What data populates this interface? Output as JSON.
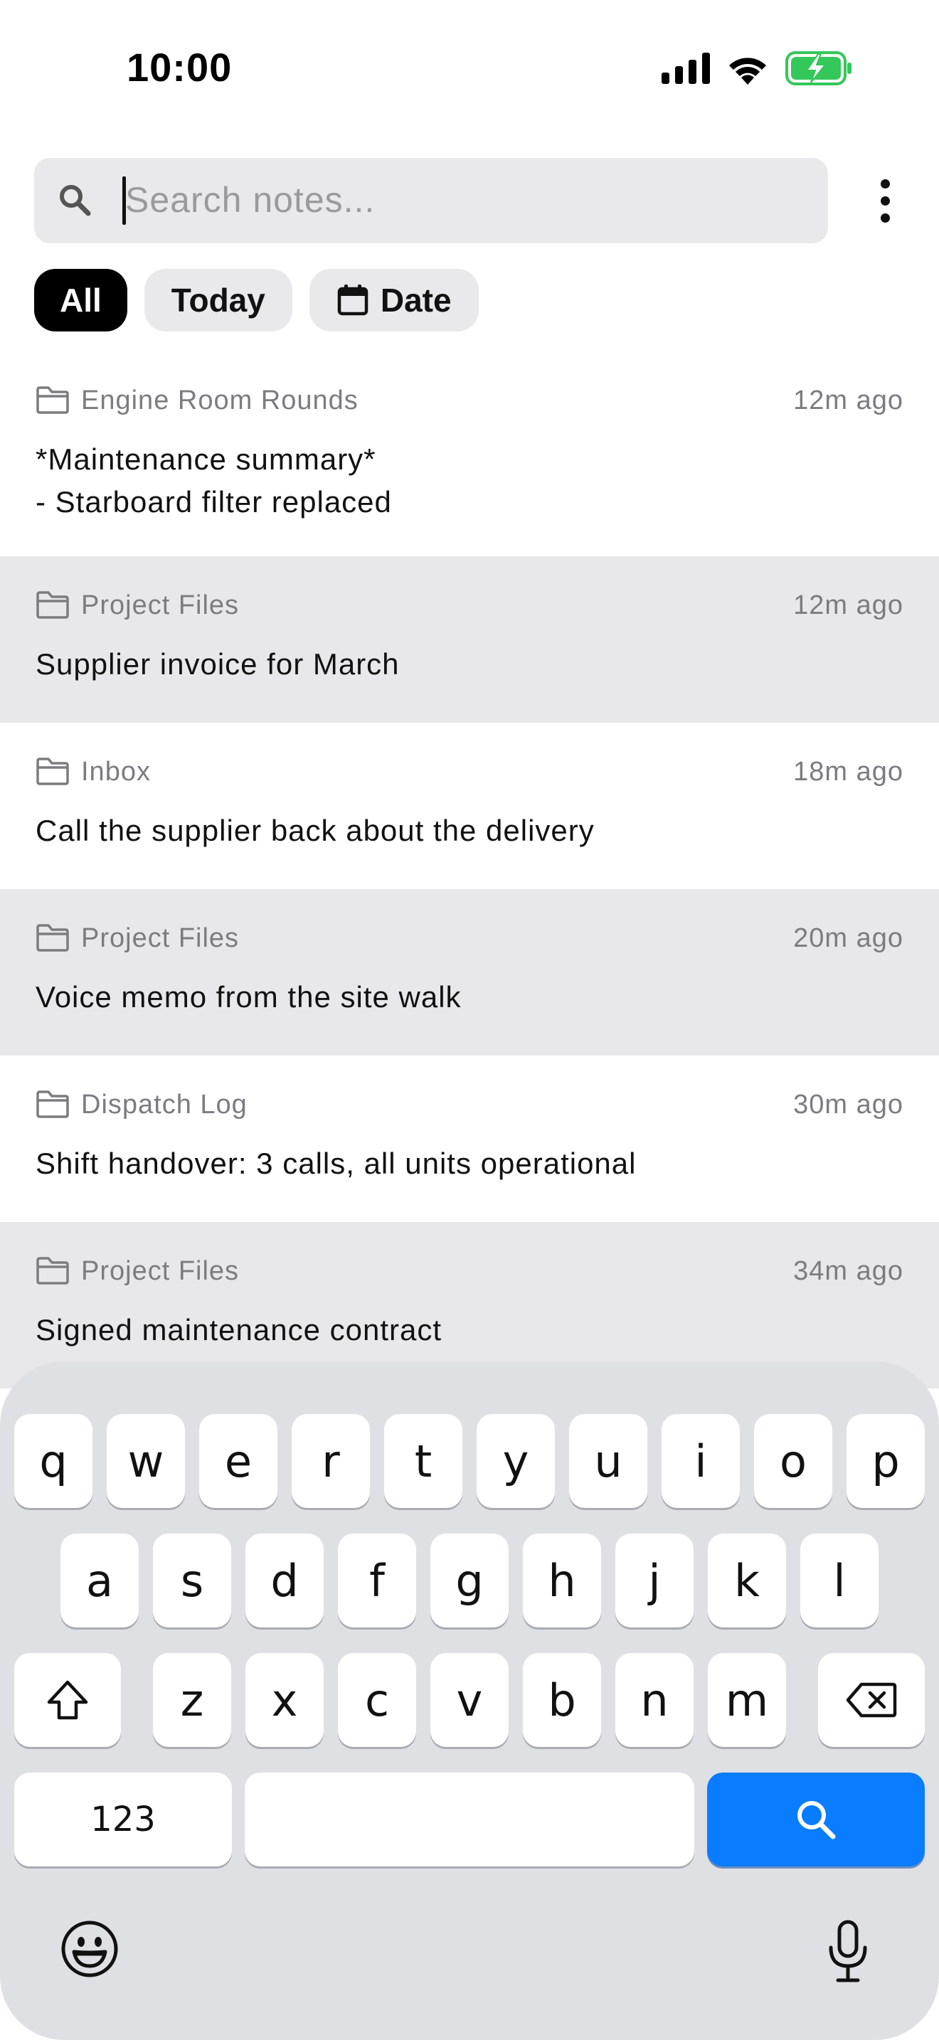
{
  "status": {
    "time": "10:00"
  },
  "search": {
    "placeholder": "Search notes..."
  },
  "filters": [
    {
      "label": "All",
      "active": true
    },
    {
      "label": "Today",
      "active": false
    },
    {
      "label": "Date",
      "active": false,
      "icon": "calendar-icon"
    }
  ],
  "notes": [
    {
      "folder": "Engine Room Rounds",
      "time": "12m ago",
      "body": "*Maintenance summary*\n- Starboard filter replaced"
    },
    {
      "folder": "Project Files",
      "time": "12m ago",
      "body": "Supplier invoice for March"
    },
    {
      "folder": "Inbox",
      "time": "18m ago",
      "body": "Call the supplier back about the delivery"
    },
    {
      "folder": "Project Files",
      "time": "20m ago",
      "body": "Voice memo from the site walk"
    },
    {
      "folder": "Dispatch Log",
      "time": "30m ago",
      "body": "Shift handover: 3 calls, all units operational"
    },
    {
      "folder": "Project Files",
      "time": "34m ago",
      "body": "Signed maintenance contract"
    }
  ],
  "keyboard": {
    "row1": [
      "q",
      "w",
      "e",
      "r",
      "t",
      "y",
      "u",
      "i",
      "o",
      "p"
    ],
    "row2": [
      "a",
      "s",
      "d",
      "f",
      "g",
      "h",
      "j",
      "k",
      "l"
    ],
    "row3": [
      "z",
      "x",
      "c",
      "v",
      "b",
      "n",
      "m"
    ],
    "numbers_label": "123"
  },
  "colors": {
    "accent": "#0a7cff",
    "battery": "#34c759"
  }
}
